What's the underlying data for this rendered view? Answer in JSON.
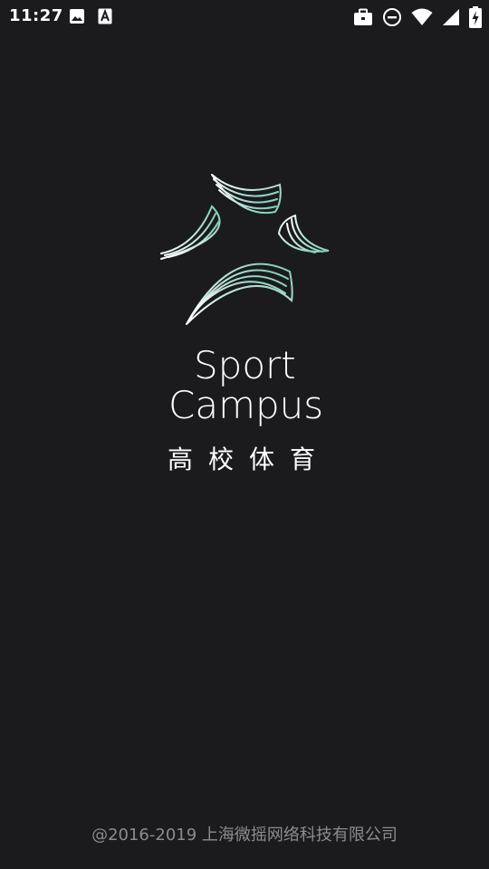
{
  "status_bar": {
    "time": "11:27",
    "icons": [
      "image-icon",
      "font-icon",
      "briefcase-icon",
      "do-not-disturb-icon",
      "wifi-icon",
      "signal-icon",
      "battery-charging-icon"
    ]
  },
  "splash": {
    "brand_line1": "Sport",
    "brand_line2": "Campus",
    "brand_chinese": "高校体育",
    "logo_icon": "sport-campus-logo-icon",
    "logo_colors": [
      "#a8e0cf",
      "#ffffff",
      "#7fcdb7"
    ]
  },
  "footer": {
    "copyright": "@2016-2019 上海微摇网络科技有限公司"
  },
  "colors": {
    "background": "#1b1b1e",
    "text": "#ffffff",
    "footer_text": "#8c8c90"
  }
}
